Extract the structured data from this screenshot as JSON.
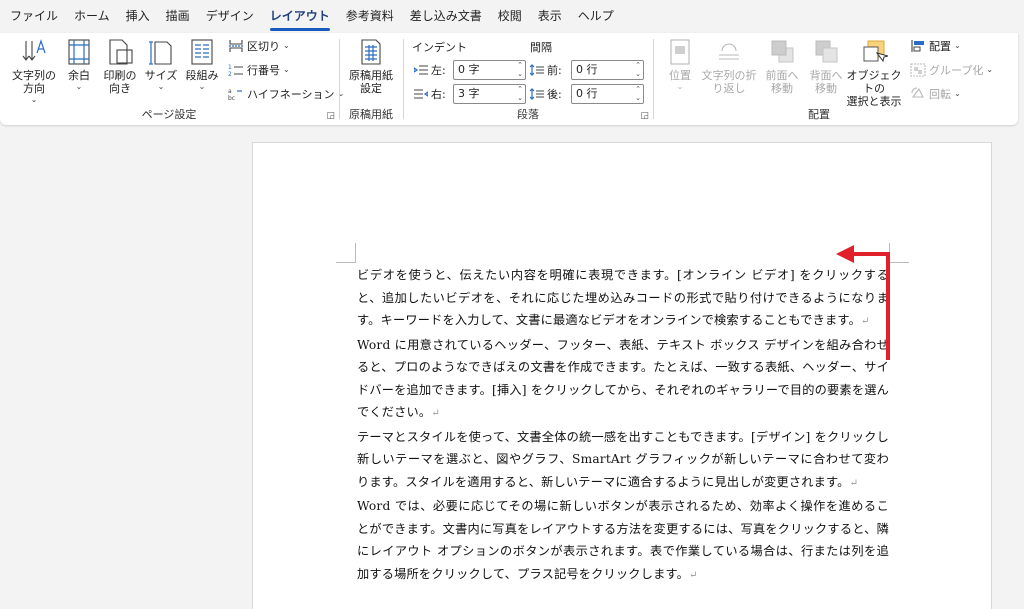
{
  "menu": {
    "tabs": [
      "ファイル",
      "ホーム",
      "挿入",
      "描画",
      "デザイン",
      "レイアウト",
      "参考資料",
      "差し込み文書",
      "校閲",
      "表示",
      "ヘルプ"
    ],
    "active_tab": "レイアウト"
  },
  "ribbon": {
    "page_setup": {
      "label": "ページ設定",
      "text_direction": "文字列の\n方向",
      "margins": "余白",
      "orientation": "印刷の\n向き",
      "size": "サイズ",
      "columns": "段組み",
      "breaks": "区切り",
      "line_numbers": "行番号",
      "hyphenation": "ハイフネーション"
    },
    "manuscript": {
      "label": "原稿用紙",
      "settings": "原稿用紙\n設定"
    },
    "paragraph": {
      "label": "段落",
      "indent_header": "インデント",
      "spacing_header": "間隔",
      "left_label": "左:",
      "left_value": "0 字",
      "right_label": "右:",
      "right_value": "3 字",
      "before_label": "前:",
      "before_value": "0 行",
      "after_label": "後:",
      "after_value": "0 行"
    },
    "arrange": {
      "label": "配置",
      "position": "位置",
      "wrap_text": "文字列の折\nり返し",
      "bring_forward": "前面へ\n移動",
      "send_backward": "背面へ\n移動",
      "selection_pane": "オブジェクトの\n選択と表示",
      "align": "配置",
      "group": "グループ化",
      "rotate": "回転"
    }
  },
  "document": {
    "paragraphs": [
      "ビデオを使うと、伝えたい内容を明確に表現できます。[オンライン ビデオ] をクリックすると、追加したいビデオを、それに応じた埋め込みコードの形式で貼り付けできるようになります。キーワードを入力して、文書に最適なビデオをオンラインで検索することもできます。",
      "Word に用意されているヘッダー、フッター、表紙、テキスト ボックス デザインを組み合わせると、プロのようなできばえの文書を作成できます。たとえば、一致する表紙、ヘッダー、サイドバーを追加できます。[挿入] をクリックしてから、それぞれのギャラリーで目的の要素を選んでください。",
      "テーマとスタイルを使って、文書全体の統一感を出すこともできます。[デザイン] をクリックし新しいテーマを選ぶと、図やグラフ、SmartArt グラフィックが新しいテーマに合わせて変わります。スタイルを適用すると、新しいテーマに適合するように見出しが変更されます。",
      "Word では、必要に応じてその場に新しいボタンが表示されるため、効率よく操作を進めることができます。文書内に写真をレイアウトする方法を変更するには、写真をクリックすると、隣にレイアウト オプションのボタンが表示されます。表で作業している場合は、行または列を追加する場所をクリックして、プラス記号をクリックします。"
    ],
    "pilcrow": "↵"
  },
  "colors": {
    "accent": "#185abd",
    "annotation": "#e0202a"
  }
}
